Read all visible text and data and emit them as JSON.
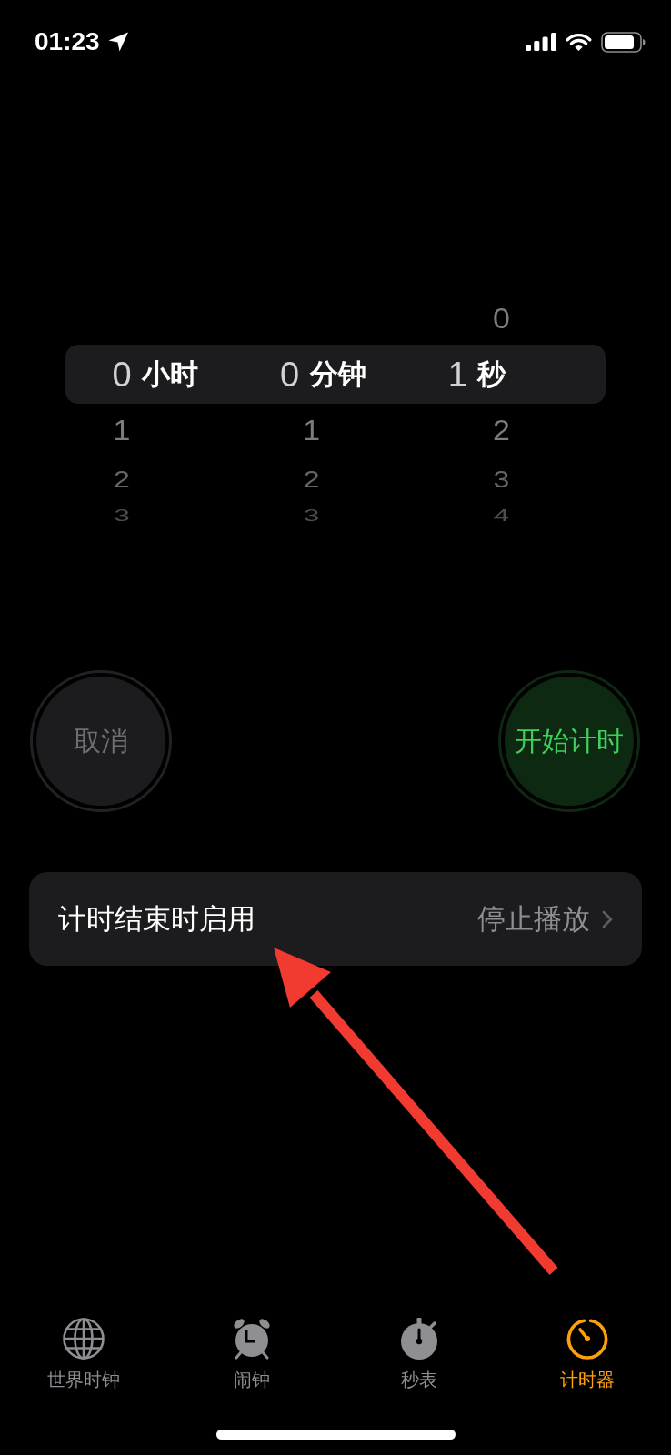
{
  "status_bar": {
    "time": "01:23"
  },
  "timer_picker": {
    "columns": [
      {
        "unit": "小时",
        "values": [
          {
            "text": "0",
            "selected": true
          },
          {
            "text": "1",
            "selected": false
          },
          {
            "text": "2",
            "selected": false
          },
          {
            "text": "3",
            "selected": false
          }
        ]
      },
      {
        "unit": "分钟",
        "values": [
          {
            "text": "0",
            "selected": true
          },
          {
            "text": "1",
            "selected": false
          },
          {
            "text": "2",
            "selected": false
          },
          {
            "text": "3",
            "selected": false
          }
        ]
      },
      {
        "unit": "秒",
        "values": [
          {
            "text": "0",
            "selected": false
          },
          {
            "text": "1",
            "selected": true
          },
          {
            "text": "2",
            "selected": false
          },
          {
            "text": "3",
            "selected": false
          },
          {
            "text": "4",
            "selected": false
          }
        ]
      }
    ]
  },
  "buttons": [
    {
      "label": "取消",
      "kind": "cancel",
      "disabled": true
    },
    {
      "label": "开始计时",
      "kind": "start",
      "disabled": false
    }
  ],
  "settings_row": {
    "label": "计时结束时启用",
    "value": "停止播放"
  },
  "tab_bar": {
    "tabs": [
      {
        "label": "世界时钟",
        "kind": "globe",
        "selected": false
      },
      {
        "label": "闹钟",
        "kind": "alarm",
        "selected": false
      },
      {
        "label": "秒表",
        "kind": "stopwatch",
        "selected": false
      },
      {
        "label": "计时器",
        "kind": "timer",
        "selected": true
      }
    ]
  },
  "annotations": [
    {
      "kind": "arrow"
    }
  ]
}
